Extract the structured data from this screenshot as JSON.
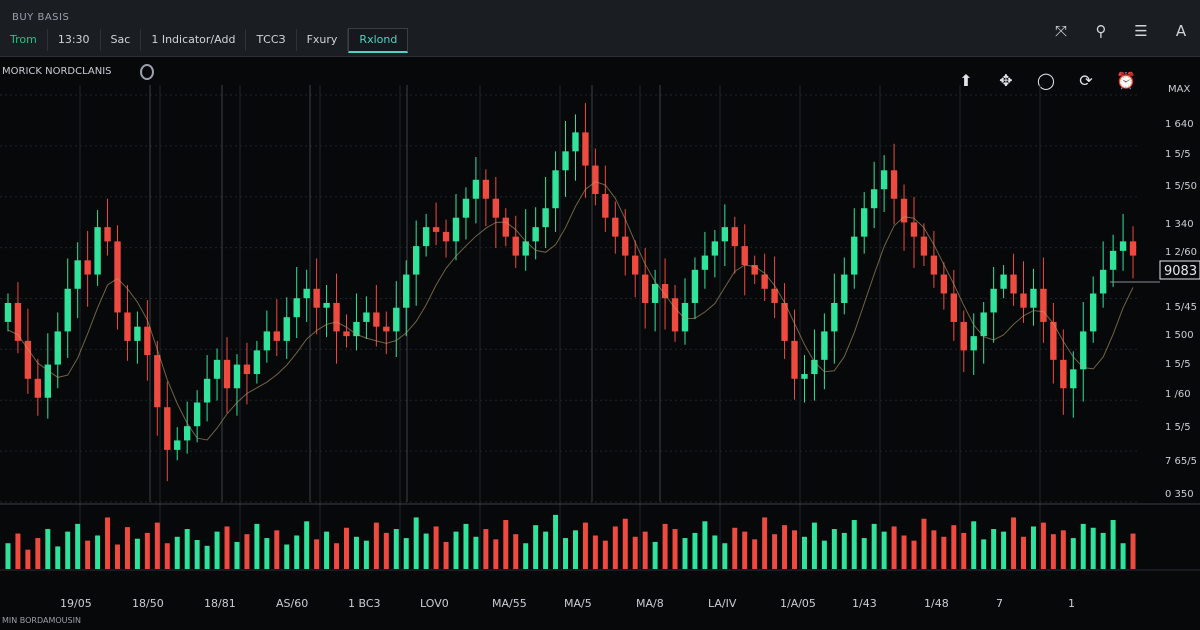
{
  "app": {
    "name": "BUY BASIS"
  },
  "toolbar": {
    "items": [
      {
        "label": "Trom",
        "style": "green"
      },
      {
        "label": "13:30",
        "style": "normal"
      },
      {
        "label": "Sac",
        "style": "normal"
      },
      {
        "label": "1 Indicator/Add",
        "style": "normal"
      },
      {
        "label": "ТССЗ",
        "style": "normal"
      },
      {
        "label": "Fxury",
        "style": "normal"
      },
      {
        "label": "Rxlond",
        "style": "active"
      }
    ],
    "icons": [
      {
        "name": "crosshair-icon",
        "glyph": "⤧"
      },
      {
        "name": "search-icon",
        "glyph": "⚲"
      },
      {
        "name": "menu-icon",
        "glyph": "☰"
      },
      {
        "name": "account-icon",
        "glyph": "A"
      }
    ]
  },
  "chart_header": {
    "title": "MORICK NORDCLANIS"
  },
  "chart_tools": [
    {
      "name": "arrow-icon",
      "glyph": "⬆"
    },
    {
      "name": "drag-icon",
      "glyph": "✥"
    },
    {
      "name": "circle-icon",
      "glyph": "◯"
    },
    {
      "name": "refresh-icon",
      "glyph": "⟳"
    },
    {
      "name": "alarm-icon",
      "glyph": "⏰"
    }
  ],
  "colors": {
    "up": "#2fe39a",
    "down": "#ef4a3f",
    "grid": "#1f242b",
    "axis_text": "#c9ced6",
    "price_tag": "#e6e9ee"
  },
  "chart_data": {
    "type": "candlestick",
    "max_label": "MAX",
    "price_tag": "9083",
    "y_tick_labels": [
      "1 640",
      "1 5/5",
      "1 5/50",
      "1 340",
      "1 2/60",
      "1 5/45",
      "1 500",
      "1 5/5",
      "1 /60",
      "1 5/5",
      "7 65/5",
      "0 350"
    ],
    "x_tick_labels": [
      "19/05",
      "18/50",
      "18/81",
      "AS/60",
      "1 BC3",
      "LOV0",
      "MA/55",
      "MA/5",
      "MA/8",
      "LA/IV",
      "1/A/05",
      "1/43",
      "1/48",
      "7",
      "1"
    ],
    "closes": [
      1330,
      1290,
      1250,
      1230,
      1265,
      1300,
      1345,
      1375,
      1360,
      1410,
      1395,
      1320,
      1290,
      1305,
      1275,
      1220,
      1175,
      1185,
      1200,
      1225,
      1250,
      1270,
      1240,
      1265,
      1255,
      1280,
      1300,
      1290,
      1315,
      1335,
      1345,
      1325,
      1330,
      1300,
      1295,
      1310,
      1320,
      1305,
      1300,
      1325,
      1360,
      1390,
      1410,
      1405,
      1395,
      1420,
      1440,
      1460,
      1440,
      1420,
      1400,
      1380,
      1395,
      1410,
      1430,
      1470,
      1490,
      1510,
      1475,
      1445,
      1420,
      1400,
      1380,
      1360,
      1330,
      1350,
      1335,
      1300,
      1330,
      1365,
      1380,
      1395,
      1410,
      1390,
      1370,
      1360,
      1345,
      1330,
      1290,
      1250,
      1255,
      1270,
      1300,
      1330,
      1360,
      1400,
      1430,
      1450,
      1470,
      1440,
      1415,
      1400,
      1380,
      1360,
      1340,
      1310,
      1280,
      1295,
      1320,
      1345,
      1360,
      1340,
      1325,
      1345,
      1310,
      1270,
      1240,
      1260,
      1300,
      1340,
      1365,
      1385,
      1395,
      1380
    ],
    "volumes": [
      40,
      55,
      30,
      48,
      62,
      35,
      58,
      70,
      44,
      52,
      80,
      38,
      65,
      47,
      56,
      72,
      40,
      50,
      62,
      45,
      36,
      58,
      66,
      42,
      54,
      70,
      48,
      60,
      38,
      52,
      74,
      46,
      58,
      40,
      64,
      50,
      44,
      72,
      56,
      62,
      48,
      80,
      55,
      66,
      42,
      58,
      70,
      50,
      62,
      46,
      76,
      54,
      40,
      68,
      58,
      84,
      48,
      60,
      72,
      52,
      44,
      66,
      78,
      50,
      58,
      42,
      70,
      62,
      48,
      56,
      74,
      52,
      40,
      64,
      58,
      46,
      80,
      54,
      68,
      60,
      50,
      72,
      44,
      62,
      56,
      76,
      48,
      70,
      58,
      66,
      52,
      44,
      78,
      60,
      50,
      68,
      56,
      74,
      46,
      62,
      58,
      80,
      50,
      66,
      72,
      54,
      60,
      48,
      70,
      64,
      56,
      76
    ]
  },
  "footer": {
    "label": "MIN BORDAMOUSIN"
  }
}
